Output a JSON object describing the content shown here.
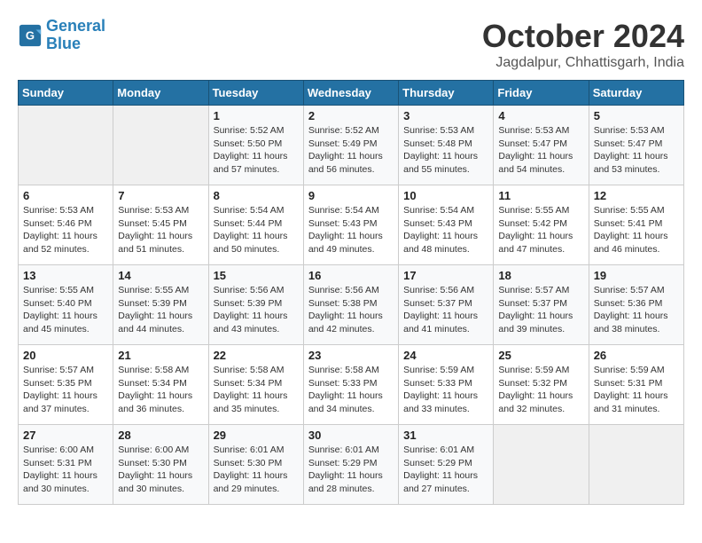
{
  "logo": {
    "line1": "General",
    "line2": "Blue"
  },
  "title": "October 2024",
  "location": "Jagdalpur, Chhattisgarh, India",
  "headers": [
    "Sunday",
    "Monday",
    "Tuesday",
    "Wednesday",
    "Thursday",
    "Friday",
    "Saturday"
  ],
  "weeks": [
    [
      {
        "day": "",
        "info": ""
      },
      {
        "day": "",
        "info": ""
      },
      {
        "day": "1",
        "info": "Sunrise: 5:52 AM\nSunset: 5:50 PM\nDaylight: 11 hours and 57 minutes."
      },
      {
        "day": "2",
        "info": "Sunrise: 5:52 AM\nSunset: 5:49 PM\nDaylight: 11 hours and 56 minutes."
      },
      {
        "day": "3",
        "info": "Sunrise: 5:53 AM\nSunset: 5:48 PM\nDaylight: 11 hours and 55 minutes."
      },
      {
        "day": "4",
        "info": "Sunrise: 5:53 AM\nSunset: 5:47 PM\nDaylight: 11 hours and 54 minutes."
      },
      {
        "day": "5",
        "info": "Sunrise: 5:53 AM\nSunset: 5:47 PM\nDaylight: 11 hours and 53 minutes."
      }
    ],
    [
      {
        "day": "6",
        "info": "Sunrise: 5:53 AM\nSunset: 5:46 PM\nDaylight: 11 hours and 52 minutes."
      },
      {
        "day": "7",
        "info": "Sunrise: 5:53 AM\nSunset: 5:45 PM\nDaylight: 11 hours and 51 minutes."
      },
      {
        "day": "8",
        "info": "Sunrise: 5:54 AM\nSunset: 5:44 PM\nDaylight: 11 hours and 50 minutes."
      },
      {
        "day": "9",
        "info": "Sunrise: 5:54 AM\nSunset: 5:43 PM\nDaylight: 11 hours and 49 minutes."
      },
      {
        "day": "10",
        "info": "Sunrise: 5:54 AM\nSunset: 5:43 PM\nDaylight: 11 hours and 48 minutes."
      },
      {
        "day": "11",
        "info": "Sunrise: 5:55 AM\nSunset: 5:42 PM\nDaylight: 11 hours and 47 minutes."
      },
      {
        "day": "12",
        "info": "Sunrise: 5:55 AM\nSunset: 5:41 PM\nDaylight: 11 hours and 46 minutes."
      }
    ],
    [
      {
        "day": "13",
        "info": "Sunrise: 5:55 AM\nSunset: 5:40 PM\nDaylight: 11 hours and 45 minutes."
      },
      {
        "day": "14",
        "info": "Sunrise: 5:55 AM\nSunset: 5:39 PM\nDaylight: 11 hours and 44 minutes."
      },
      {
        "day": "15",
        "info": "Sunrise: 5:56 AM\nSunset: 5:39 PM\nDaylight: 11 hours and 43 minutes."
      },
      {
        "day": "16",
        "info": "Sunrise: 5:56 AM\nSunset: 5:38 PM\nDaylight: 11 hours and 42 minutes."
      },
      {
        "day": "17",
        "info": "Sunrise: 5:56 AM\nSunset: 5:37 PM\nDaylight: 11 hours and 41 minutes."
      },
      {
        "day": "18",
        "info": "Sunrise: 5:57 AM\nSunset: 5:37 PM\nDaylight: 11 hours and 39 minutes."
      },
      {
        "day": "19",
        "info": "Sunrise: 5:57 AM\nSunset: 5:36 PM\nDaylight: 11 hours and 38 minutes."
      }
    ],
    [
      {
        "day": "20",
        "info": "Sunrise: 5:57 AM\nSunset: 5:35 PM\nDaylight: 11 hours and 37 minutes."
      },
      {
        "day": "21",
        "info": "Sunrise: 5:58 AM\nSunset: 5:34 PM\nDaylight: 11 hours and 36 minutes."
      },
      {
        "day": "22",
        "info": "Sunrise: 5:58 AM\nSunset: 5:34 PM\nDaylight: 11 hours and 35 minutes."
      },
      {
        "day": "23",
        "info": "Sunrise: 5:58 AM\nSunset: 5:33 PM\nDaylight: 11 hours and 34 minutes."
      },
      {
        "day": "24",
        "info": "Sunrise: 5:59 AM\nSunset: 5:33 PM\nDaylight: 11 hours and 33 minutes."
      },
      {
        "day": "25",
        "info": "Sunrise: 5:59 AM\nSunset: 5:32 PM\nDaylight: 11 hours and 32 minutes."
      },
      {
        "day": "26",
        "info": "Sunrise: 5:59 AM\nSunset: 5:31 PM\nDaylight: 11 hours and 31 minutes."
      }
    ],
    [
      {
        "day": "27",
        "info": "Sunrise: 6:00 AM\nSunset: 5:31 PM\nDaylight: 11 hours and 30 minutes."
      },
      {
        "day": "28",
        "info": "Sunrise: 6:00 AM\nSunset: 5:30 PM\nDaylight: 11 hours and 30 minutes."
      },
      {
        "day": "29",
        "info": "Sunrise: 6:01 AM\nSunset: 5:30 PM\nDaylight: 11 hours and 29 minutes."
      },
      {
        "day": "30",
        "info": "Sunrise: 6:01 AM\nSunset: 5:29 PM\nDaylight: 11 hours and 28 minutes."
      },
      {
        "day": "31",
        "info": "Sunrise: 6:01 AM\nSunset: 5:29 PM\nDaylight: 11 hours and 27 minutes."
      },
      {
        "day": "",
        "info": ""
      },
      {
        "day": "",
        "info": ""
      }
    ]
  ]
}
